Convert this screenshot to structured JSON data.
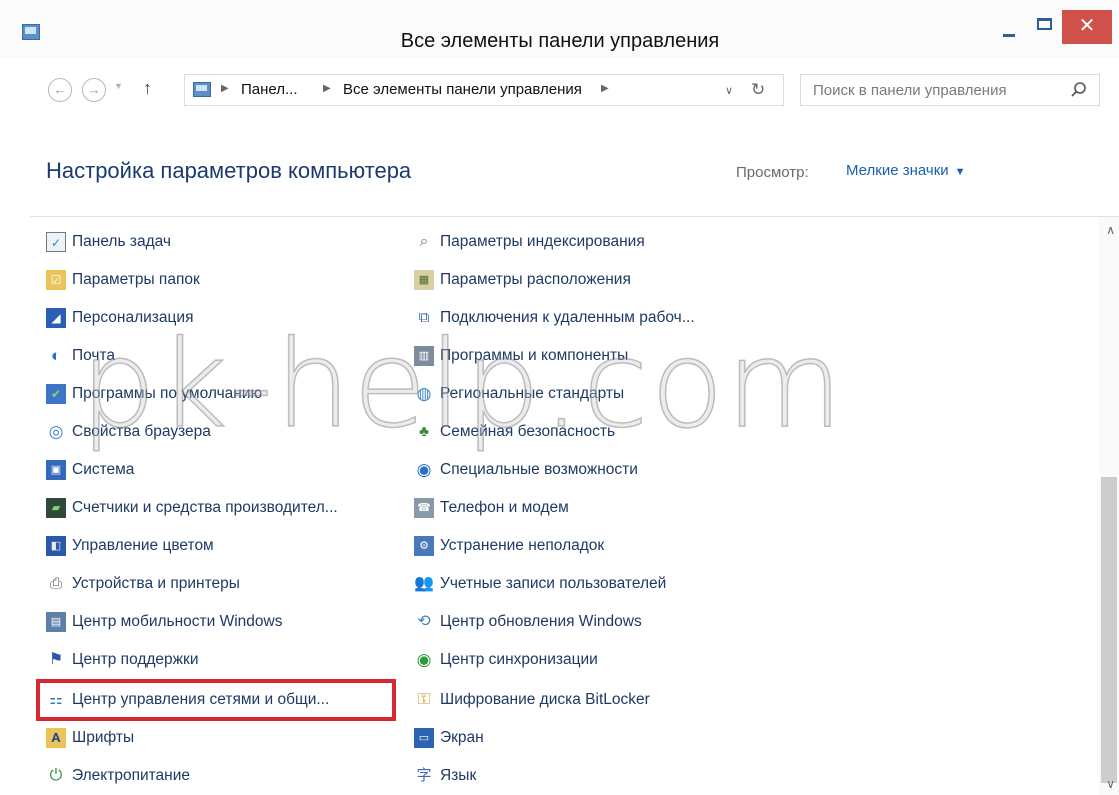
{
  "window": {
    "title": "Все элементы панели управления",
    "close_glyph": "✕"
  },
  "address": {
    "crumbs": [
      "Панел...",
      "Все элементы панели управления"
    ],
    "search_placeholder": "Поиск в панели управления"
  },
  "header": {
    "heading": "Настройка параметров компьютера",
    "view_label": "Просмотр:",
    "view_value": "Мелкие значки"
  },
  "items": {
    "left": [
      {
        "label": "Панель задач",
        "icon": "taskbar-icon"
      },
      {
        "label": "Параметры папок",
        "icon": "folder-options-icon"
      },
      {
        "label": "Персонализация",
        "icon": "personalization-icon"
      },
      {
        "label": "Почта",
        "icon": "mail-icon"
      },
      {
        "label": "Программы по умолчанию",
        "icon": "default-programs-icon"
      },
      {
        "label": "Свойства браузера",
        "icon": "browser-properties-icon"
      },
      {
        "label": "Система",
        "icon": "system-icon"
      },
      {
        "label": "Счетчики и средства производител...",
        "icon": "performance-icon"
      },
      {
        "label": "Управление цветом",
        "icon": "color-management-icon"
      },
      {
        "label": "Устройства и принтеры",
        "icon": "devices-printers-icon"
      },
      {
        "label": "Центр мобильности Windows",
        "icon": "mobility-center-icon"
      },
      {
        "label": "Центр поддержки",
        "icon": "action-center-flag-icon"
      },
      {
        "label": "Центр управления сетями и общи...",
        "icon": "network-sharing-icon"
      },
      {
        "label": "Шрифты",
        "icon": "fonts-icon"
      },
      {
        "label": "Электропитание",
        "icon": "power-options-icon"
      }
    ],
    "right": [
      {
        "label": "Параметры индексирования",
        "icon": "indexing-icon"
      },
      {
        "label": "Параметры расположения",
        "icon": "location-icon"
      },
      {
        "label": "Подключения к удаленным рабоч...",
        "icon": "remote-desktop-icon"
      },
      {
        "label": "Программы и компоненты",
        "icon": "programs-features-icon"
      },
      {
        "label": "Региональные стандарты",
        "icon": "region-globe-icon"
      },
      {
        "label": "Семейная безопасность",
        "icon": "family-safety-icon"
      },
      {
        "label": "Специальные возможности",
        "icon": "ease-of-access-icon"
      },
      {
        "label": "Телефон и модем",
        "icon": "phone-modem-icon"
      },
      {
        "label": "Устранение неполадок",
        "icon": "troubleshooting-icon"
      },
      {
        "label": "Учетные записи пользователей",
        "icon": "user-accounts-icon"
      },
      {
        "label": "Центр обновления Windows",
        "icon": "windows-update-icon"
      },
      {
        "label": "Центр синхронизации",
        "icon": "sync-center-icon"
      },
      {
        "label": "Шифрование диска BitLocker",
        "icon": "bitlocker-icon"
      },
      {
        "label": "Экран",
        "icon": "display-icon"
      },
      {
        "label": "Язык",
        "icon": "language-icon"
      }
    ]
  },
  "watermark": "pk-help.com",
  "colors": {
    "highlight": "#d6282f",
    "link": "#1e3a64",
    "heading": "#1c3a70",
    "close_button": "#d0504b"
  }
}
